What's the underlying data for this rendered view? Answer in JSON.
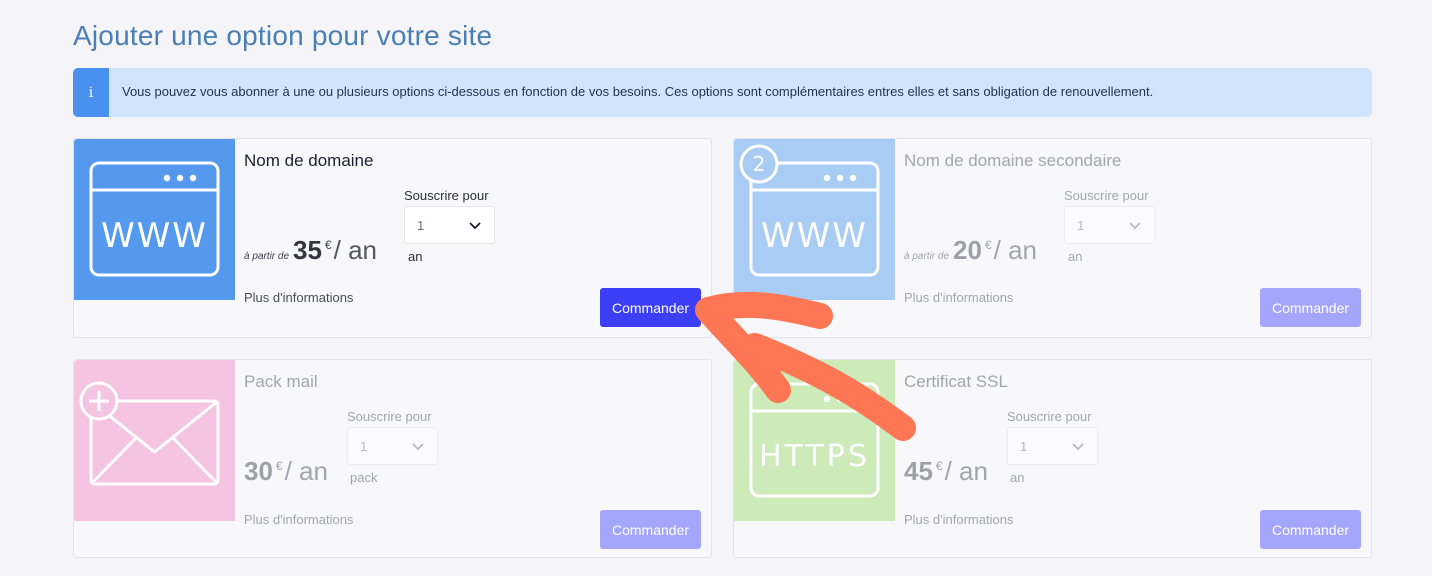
{
  "page": {
    "title": "Ajouter une option pour votre site"
  },
  "info": {
    "icon": "i",
    "text": "Vous pouvez vous abonner à une ou plusieurs options ci-dessous en fonction de vos besoins. Ces options sont complémentaires entres elles et sans obligation de renouvellement."
  },
  "colors": {
    "title": "#4a7fb5",
    "info_bg": "#d0e4fc",
    "info_icon_bg": "#4a90ee",
    "primary_button": "#3c3ff5",
    "disabled_button": "#a3a6fb",
    "annotation_arrow": "#ff7655"
  },
  "cards": [
    {
      "name": "Nom de domaine",
      "icon": "www-browser-icon",
      "thumb_text": "WWW",
      "thumb_color": "#5599ee",
      "subscribe_label": "Souscrire pour",
      "quantity": "1",
      "price_prefix": "à partir de",
      "price": "35",
      "currency": "€",
      "period": "/ an",
      "unit": "an",
      "more_info": "Plus d'informations",
      "order_label": "Commander",
      "state": "active"
    },
    {
      "name": "Nom de domaine secondaire",
      "icon": "secondary-www-browser-icon",
      "thumb_text": "WWW",
      "badge": "2",
      "thumb_color": "#a9ccf5",
      "subscribe_label": "Souscrire pour",
      "quantity": "1",
      "price_prefix": "à partir de",
      "price": "20",
      "currency": "€",
      "period": "/ an",
      "unit": "an",
      "more_info": "Plus d'informations",
      "order_label": "Commander",
      "state": "muted"
    },
    {
      "name": "Pack mail",
      "icon": "mail-plus-icon",
      "thumb_color": "#f5c4e2",
      "subscribe_label": "Souscrire pour",
      "quantity": "1",
      "price": "30",
      "currency": "€",
      "period": "/ an",
      "unit": "pack",
      "more_info": "Plus d'informations",
      "order_label": "Commander",
      "state": "muted"
    },
    {
      "name": "Certificat SSL",
      "icon": "https-browser-icon",
      "thumb_text": "HTTPS",
      "thumb_color": "#cdeab9",
      "subscribe_label": "Souscrire pour",
      "quantity": "1",
      "price": "45",
      "currency": "€",
      "period": "/ an",
      "unit": "an",
      "more_info": "Plus d'informations",
      "order_label": "Commander",
      "state": "muted"
    }
  ]
}
